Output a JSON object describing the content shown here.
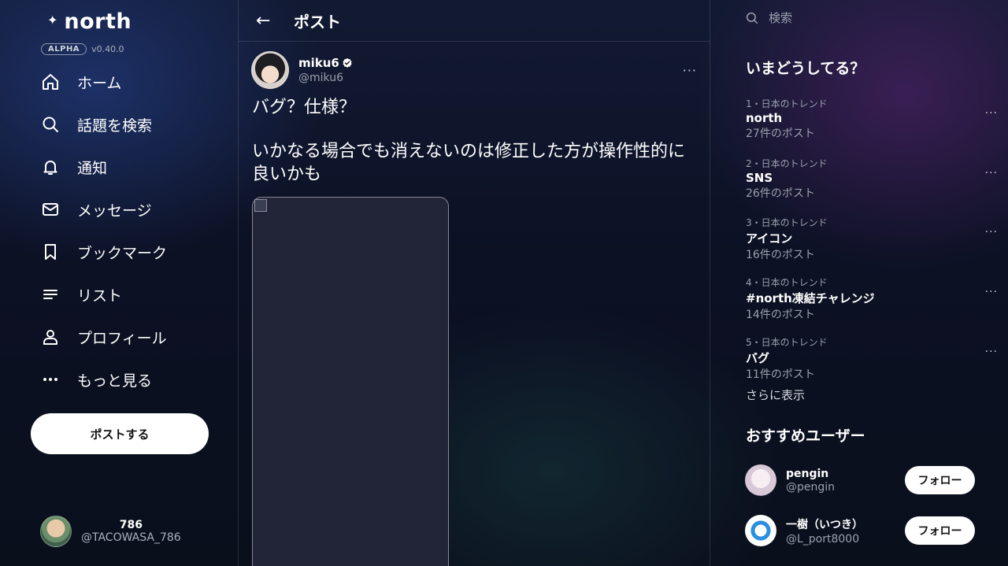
{
  "app": {
    "logo_text": "north",
    "badge": "ALPHA",
    "version": "v0.40.0"
  },
  "nav": {
    "items": [
      {
        "label": "ホーム",
        "icon": "home-icon"
      },
      {
        "label": "話題を検索",
        "icon": "search-icon"
      },
      {
        "label": "通知",
        "icon": "bell-icon"
      },
      {
        "label": "メッセージ",
        "icon": "mail-icon"
      },
      {
        "label": "ブックマーク",
        "icon": "bookmark-icon"
      },
      {
        "label": "リスト",
        "icon": "list-icon"
      },
      {
        "label": "プロフィール",
        "icon": "person-icon"
      },
      {
        "label": "もっと見る",
        "icon": "more-icon"
      }
    ],
    "post_button": "ポストする"
  },
  "account": {
    "name": "786",
    "handle": "@TACOWASA_786"
  },
  "center": {
    "header_title": "ポスト",
    "back_icon": "←",
    "post": {
      "author_name": "miku6",
      "author_handle": "@miku6",
      "more_icon": "···",
      "text_line1": "バグ？仕様？",
      "text_line2": "いかなる場合でも消えないのは修正した方が操作性的に良いかも"
    }
  },
  "right": {
    "search_placeholder": "検索",
    "trends_title": "いまどうしてる？",
    "trends": [
      {
        "meta": "1・日本のトレンド",
        "name": "north",
        "count": "27件のポスト"
      },
      {
        "meta": "2・日本のトレンド",
        "name": "SNS",
        "count": "26件のポスト"
      },
      {
        "meta": "3・日本のトレンド",
        "name": "アイコン",
        "count": "16件のポスト"
      },
      {
        "meta": "4・日本のトレンド",
        "name": "#north凍結チャレンジ",
        "count": "14件のポスト"
      },
      {
        "meta": "5・日本のトレンド",
        "name": "バグ",
        "count": "11件のポスト"
      }
    ],
    "show_more": "さらに表示",
    "users_title": "おすすめユーザー",
    "users": [
      {
        "name": "pengin",
        "handle": "@pengin",
        "follow": "フォロー"
      },
      {
        "name": "一樹（いつき）",
        "handle": "@L_port8000",
        "follow": "フォロー"
      }
    ],
    "more_icon": "···"
  },
  "colors": {
    "background": "#0c1124",
    "button_bg": "#ffffff",
    "muted_text": "#9aa0ac"
  }
}
